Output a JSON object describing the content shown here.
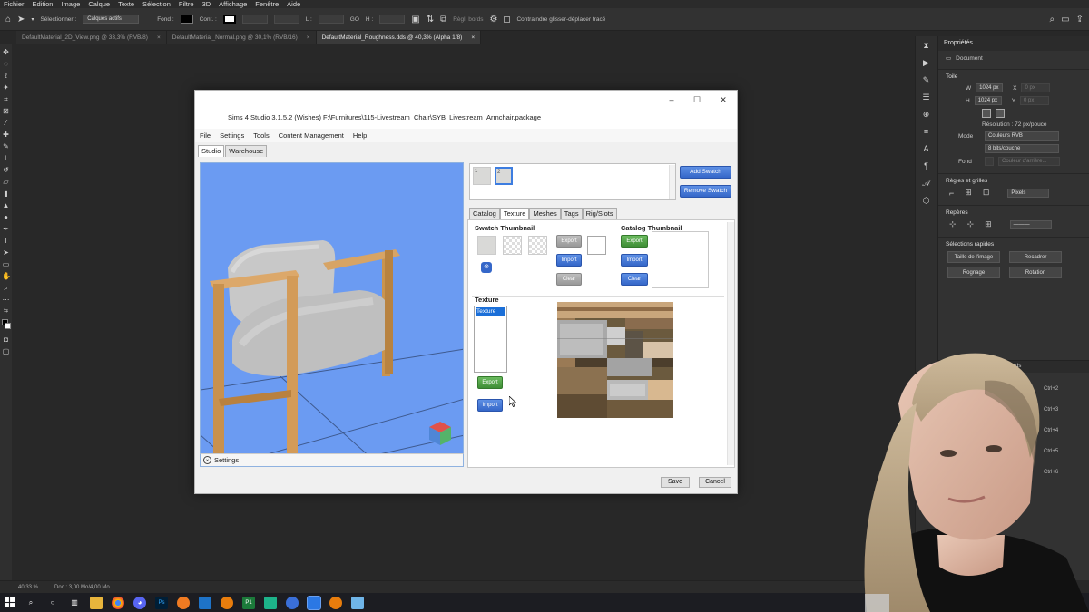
{
  "photoshop": {
    "menu": [
      "Fichier",
      "Edition",
      "Image",
      "Calque",
      "Texte",
      "Sélection",
      "Filtre",
      "3D",
      "Affichage",
      "Fenêtre",
      "Aide"
    ],
    "options": {
      "select_label": "Sélectionner :",
      "select_value": "Calques actifs",
      "fond_label": "Fond :",
      "cont_label": "Cont. :",
      "l_label": "L :",
      "go_label": "GO",
      "h_label": "H :",
      "regle_bords": "Règl. bords",
      "constrain_label": "Contraindre glisser-déplacer tracé"
    },
    "tabs": [
      {
        "label": "DefaultMaterial_2D_View.png @ 33,3% (RVB/8)"
      },
      {
        "label": "DefaultMaterial_Normal.png @ 30,1% (RVB/16)"
      },
      {
        "label": "DefaultMaterial_Roughness.dds @ 40,3% (Alpha 1/8)"
      }
    ],
    "properties": {
      "title": "Propriétés",
      "document_label": "Document",
      "toile_title": "Toile",
      "w_label": "W",
      "w_value": "1024 px",
      "x_label": "X",
      "x_value": "0 px",
      "h_label": "H",
      "h_value": "1024 px",
      "y_label": "Y",
      "y_value": "0 px",
      "resolution": "Résolution : 72 px/pouce",
      "mode_label": "Mode",
      "mode_value": "Couleurs RVB",
      "bits_value": "8 bits/couche",
      "fond_label": "Fond",
      "fond_value": "Couleur d'arrière...",
      "regles_title": "Règles et grilles",
      "units_value": "Pixels",
      "reperes_title": "Repères",
      "selections_title": "Sélections rapides",
      "btn_taille": "Taille de l'image",
      "btn_recadrer": "Recadrer",
      "btn_rognage": "Rognage",
      "btn_rotation": "Rotation",
      "layers_partial": "...ds"
    },
    "shortcuts": [
      "Ctrl+2",
      "Ctrl+3",
      "Ctrl+4",
      "Ctrl+5",
      "Ctrl+6"
    ],
    "status": {
      "zoom": "40,33 %",
      "doc": "Doc : 3,00 Mo/4,00 Mo"
    }
  },
  "s4s": {
    "title": "Sims 4 Studio 3.1.5.2 (Wishes)  F:\\Furnitures\\115-Livestream_Chair\\SYB_Livestream_Armchair.package",
    "menu": [
      "File",
      "Settings",
      "Tools",
      "Content Management",
      "Help"
    ],
    "top_tabs": [
      "Studio",
      "Warehouse"
    ],
    "viewport_footer": "Settings",
    "swatches": [
      "1",
      "2"
    ],
    "add_swatch": "Add Swatch",
    "remove_swatch": "Remove Swatch",
    "right_tabs": [
      "Catalog",
      "Texture",
      "Meshes",
      "Tags",
      "Rig/Slots"
    ],
    "swatch_thumbnail": {
      "title": "Swatch Thumbnail",
      "export": "Export",
      "import": "Import",
      "clear": "Clear"
    },
    "catalog_thumbnail": {
      "title": "Catalog Thumbnail",
      "export": "Export",
      "import": "Import",
      "clear": "Clear"
    },
    "texture": {
      "title": "Texture",
      "list_item": "Texture",
      "export": "Export",
      "import": "Import"
    },
    "save": "Save",
    "cancel": "Cancel"
  },
  "colors": {
    "viewport_blue": "#6b9bf2",
    "selection_blue": "#1b6fd8"
  }
}
